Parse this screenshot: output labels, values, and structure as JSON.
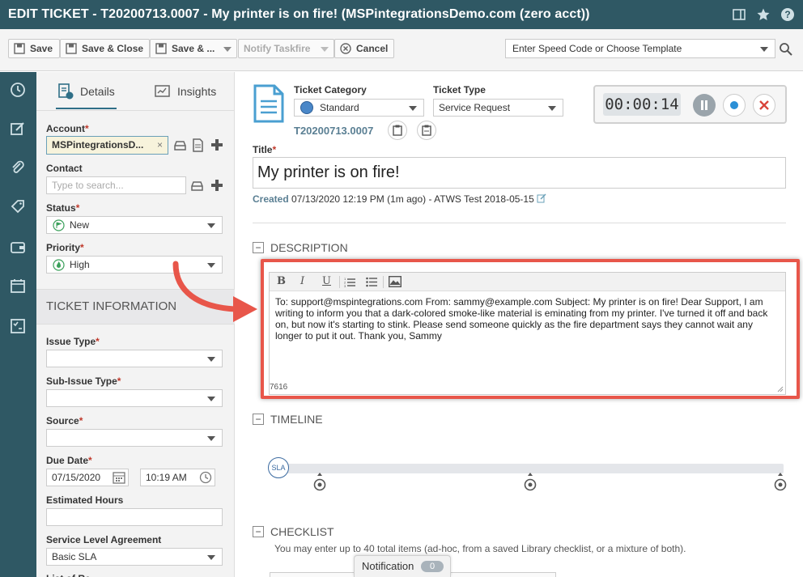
{
  "window": {
    "title": "EDIT TICKET - T20200713.0007 - My printer is on fire! (MSPintegrationsDemo.com (zero acct))"
  },
  "toolbar": {
    "save": "Save",
    "save_close": "Save & Close",
    "save_more": "Save & ...",
    "notify": "Notify Taskfire",
    "cancel": "Cancel",
    "speed_code_placeholder": "Enter Speed Code or Choose Template"
  },
  "sidebar": {
    "tabs": [
      "Details",
      "Insights"
    ],
    "account": {
      "label": "Account",
      "value": "MSPintegrationsD..."
    },
    "contact": {
      "label": "Contact",
      "placeholder": "Type to search..."
    },
    "status": {
      "label": "Status",
      "value": "New"
    },
    "priority": {
      "label": "Priority",
      "value": "High"
    },
    "section_title": "TICKET INFORMATION",
    "issue_type": {
      "label": "Issue Type",
      "value": ""
    },
    "sub_issue_type": {
      "label": "Sub-Issue Type",
      "value": ""
    },
    "source": {
      "label": "Source",
      "value": ""
    },
    "due_date": {
      "label": "Due Date",
      "date": "07/15/2020",
      "time": "10:19 AM"
    },
    "estimated_hours": {
      "label": "Estimated Hours",
      "value": ""
    },
    "sla": {
      "label": "Service Level Agreement",
      "value": "Basic SLA"
    },
    "cut_label": "List of Re..."
  },
  "header": {
    "category_label": "Ticket Category",
    "category_value": "Standard",
    "type_label": "Ticket Type",
    "type_value": "Service Request",
    "ticket_number": "T20200713.0007",
    "timer": "00:00:14"
  },
  "title_field": {
    "label": "Title",
    "value": "My printer is on fire!"
  },
  "created": {
    "label": "Created",
    "value": "07/13/2020 12:19 PM (1m ago)",
    "sep": "-",
    "by": "ATWS Test 2018-05-15"
  },
  "description": {
    "heading": "DESCRIPTION",
    "text": "To: support@mspintegrations.com From: sammy@example.com Subject: My printer is on fire! Dear Support, I am writing to inform you that a dark-colored smoke-like material is eminating from my printer. I've turned it off and back on, but now it's starting to stink. Please send someone quickly as the fire department says they cannot wait any longer to put it out. Thank you, Sammy",
    "char_count": "7616"
  },
  "timeline": {
    "heading": "TIMELINE",
    "sla_badge": "SLA"
  },
  "checklist": {
    "heading": "CHECKLIST",
    "note": "You may enter up to 40 total items (ad-hoc, from a saved Library checklist, or a mixture of both)."
  },
  "notification": {
    "label": "Notification",
    "count": "0"
  },
  "colors": {
    "header_bg": "#2f5864",
    "highlight": "#e8564a",
    "accent": "#2f6f87"
  }
}
